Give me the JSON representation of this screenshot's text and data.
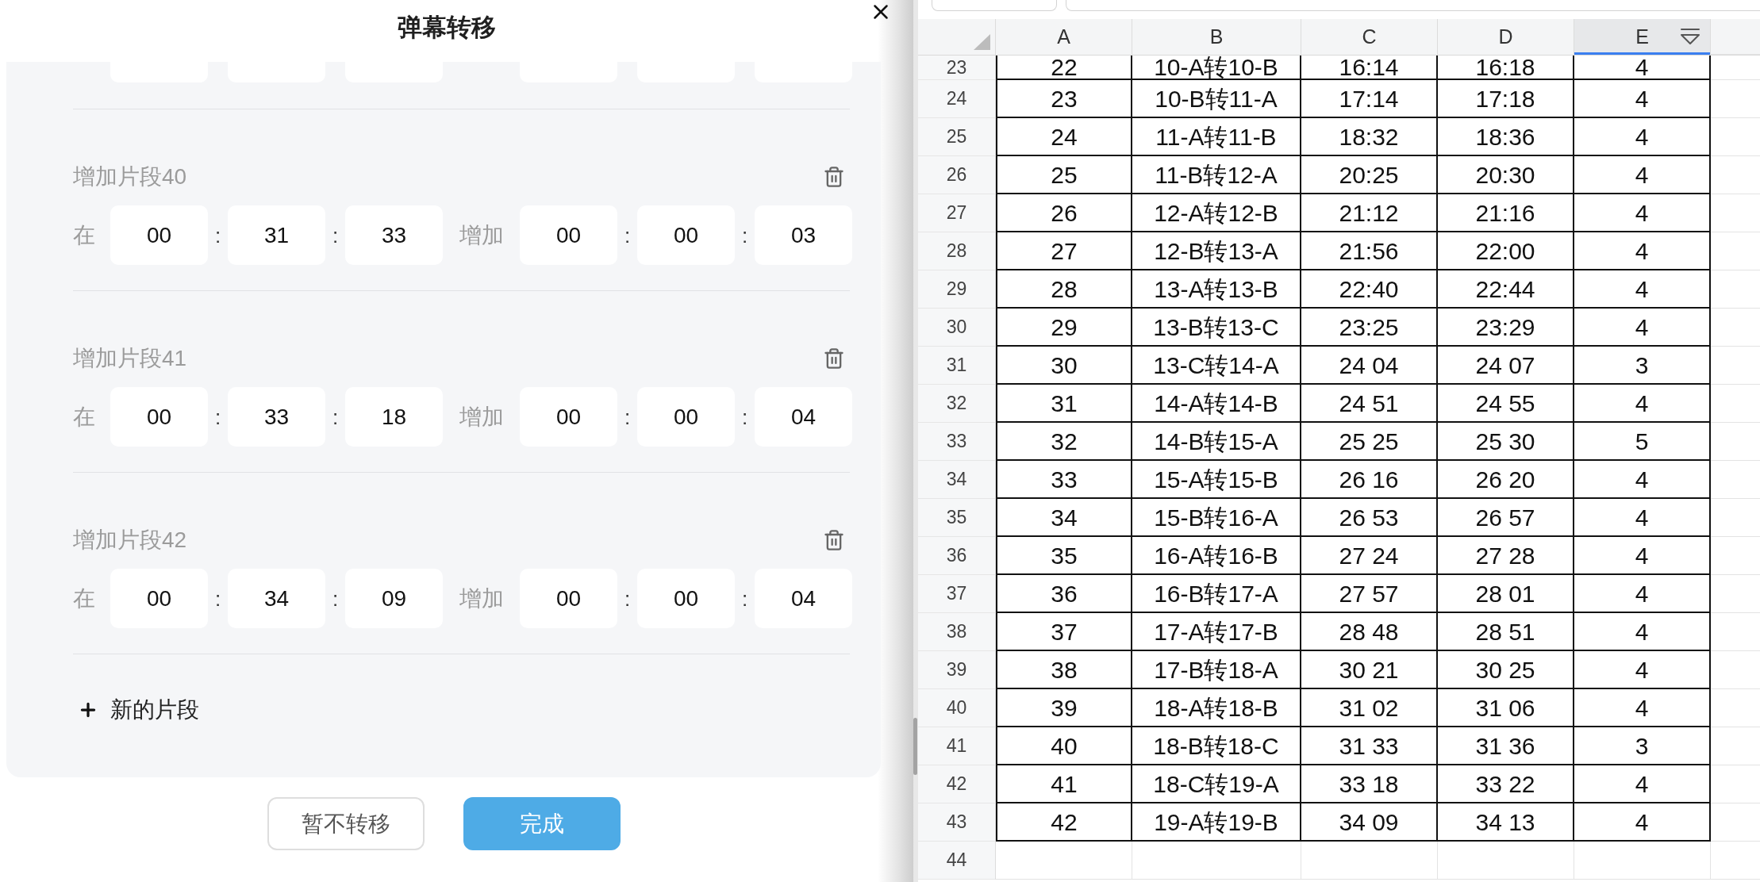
{
  "dialog": {
    "title": "弹幕转移",
    "segments": [
      {
        "kind": "clipped"
      },
      {
        "kind": "full",
        "title": "增加片段40",
        "at_label": "在",
        "start": {
          "parts": [
            "00",
            "31",
            "33"
          ],
          "separators": [
            ":",
            ":"
          ]
        },
        "add_label": "增加",
        "shift": {
          "parts": [
            "00",
            "00",
            "03"
          ],
          "separators": [
            ":",
            ":"
          ]
        }
      },
      {
        "kind": "full",
        "title": "增加片段41",
        "at_label": "在",
        "start": {
          "parts": [
            "00",
            "33",
            "18"
          ],
          "separators": [
            ":",
            ":"
          ]
        },
        "add_label": "增加",
        "shift": {
          "parts": [
            "00",
            "00",
            "04"
          ],
          "separators": [
            ":",
            ":"
          ]
        }
      },
      {
        "kind": "full",
        "title": "增加片段42",
        "at_label": "在",
        "start": {
          "parts": [
            "00",
            "34",
            "09"
          ],
          "separators": [
            ":",
            ":"
          ]
        },
        "add_label": "增加",
        "shift": {
          "parts": [
            "00",
            "00",
            "04"
          ],
          "separators": [
            ":",
            ":"
          ]
        }
      }
    ],
    "add_segment": "新的片段",
    "buttons": [
      {
        "label": "暂不转移",
        "kind": "secondary"
      },
      {
        "label": "完成",
        "kind": "primary"
      }
    ]
  },
  "sheet": {
    "columns": [
      {
        "label": "A",
        "selected": false
      },
      {
        "label": "B",
        "selected": false
      },
      {
        "label": "C",
        "selected": false
      },
      {
        "label": "D",
        "selected": false
      },
      {
        "label": "E",
        "selected": true
      }
    ],
    "rows": [
      {
        "number": "23",
        "cells": [
          "22",
          "10-A转10-B",
          "16:14",
          "16:18",
          "4"
        ]
      },
      {
        "number": "24",
        "cells": [
          "23",
          "10-B转11-A",
          "17:14",
          "17:18",
          "4"
        ]
      },
      {
        "number": "25",
        "cells": [
          "24",
          "11-A转11-B",
          "18:32",
          "18:36",
          "4"
        ]
      },
      {
        "number": "26",
        "cells": [
          "25",
          "11-B转12-A",
          "20:25",
          "20:30",
          "4"
        ]
      },
      {
        "number": "27",
        "cells": [
          "26",
          "12-A转12-B",
          "21:12",
          "21:16",
          "4"
        ]
      },
      {
        "number": "28",
        "cells": [
          "27",
          "12-B转13-A",
          "21:56",
          "22:00",
          "4"
        ]
      },
      {
        "number": "29",
        "cells": [
          "28",
          "13-A转13-B",
          "22:40",
          "22:44",
          "4"
        ]
      },
      {
        "number": "30",
        "cells": [
          "29",
          "13-B转13-C",
          "23:25",
          "23:29",
          "4"
        ]
      },
      {
        "number": "31",
        "cells": [
          "30",
          "13-C转14-A",
          "24 04",
          "24 07",
          "3"
        ]
      },
      {
        "number": "32",
        "cells": [
          "31",
          "14-A转14-B",
          "24 51",
          "24 55",
          "4"
        ]
      },
      {
        "number": "33",
        "cells": [
          "32",
          "14-B转15-A",
          "25 25",
          "25 30",
          "5"
        ]
      },
      {
        "number": "34",
        "cells": [
          "33",
          "15-A转15-B",
          "26 16",
          "26 20",
          "4"
        ]
      },
      {
        "number": "35",
        "cells": [
          "34",
          "15-B转16-A",
          "26 53",
          "26 57",
          "4"
        ]
      },
      {
        "number": "36",
        "cells": [
          "35",
          "16-A转16-B",
          "27 24",
          "27 28",
          "4"
        ]
      },
      {
        "number": "37",
        "cells": [
          "36",
          "16-B转17-A",
          "27 57",
          "28 01",
          "4"
        ]
      },
      {
        "number": "38",
        "cells": [
          "37",
          "17-A转17-B",
          "28 48",
          "28 51",
          "4"
        ]
      },
      {
        "number": "39",
        "cells": [
          "38",
          "17-B转18-A",
          "30 21",
          "30 25",
          "4"
        ]
      },
      {
        "number": "40",
        "cells": [
          "39",
          "18-A转18-B",
          "31 02",
          "31 06",
          "4"
        ]
      },
      {
        "number": "41",
        "cells": [
          "40",
          "18-B转18-C",
          "31 33",
          "31 36",
          "3"
        ]
      },
      {
        "number": "42",
        "cells": [
          "41",
          "18-C转19-A",
          "33 18",
          "33 22",
          "4"
        ]
      },
      {
        "number": "43",
        "cells": [
          "42",
          "19-A转19-B",
          "34 09",
          "34 13",
          "4"
        ]
      },
      {
        "number": "44"
      }
    ]
  }
}
